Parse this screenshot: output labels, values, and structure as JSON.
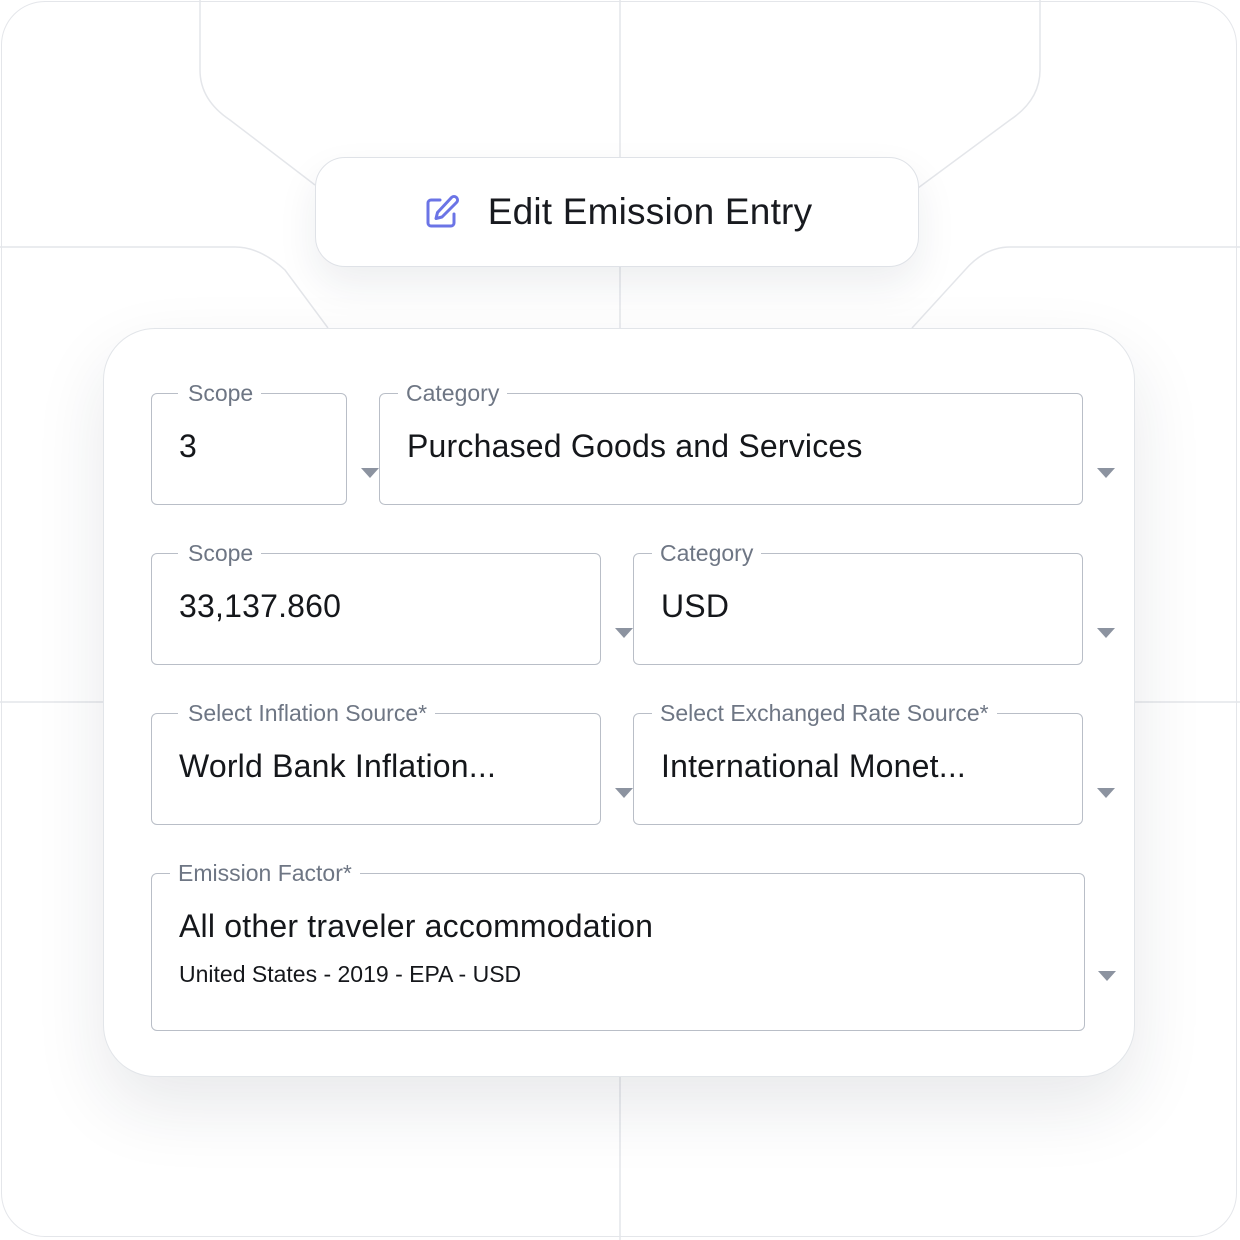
{
  "header": {
    "title": "Edit Emission Entry",
    "icon": "edit-icon",
    "accent_color": "#6b74e6"
  },
  "form": {
    "scope": {
      "label": "Scope",
      "value": "3"
    },
    "category": {
      "label": "Category",
      "value": "Purchased Goods and Services"
    },
    "amount": {
      "label": "Scope",
      "value": "33,137.860"
    },
    "currency": {
      "label": "Category",
      "value": "USD"
    },
    "inflation_source": {
      "label": "Select Inflation Source*",
      "value": "World Bank Inflation..."
    },
    "exchange_rate_source": {
      "label": "Select Exchanged Rate Source*",
      "value": "International Monet..."
    },
    "emission_factor": {
      "label": "Emission Factor*",
      "value": "All other traveler accommodation",
      "details": "United States - 2019 - EPA - USD"
    }
  },
  "colors": {
    "border": "#b9bec7",
    "label": "#6e7684",
    "text": "#15171b",
    "caret": "#8c93a0"
  }
}
